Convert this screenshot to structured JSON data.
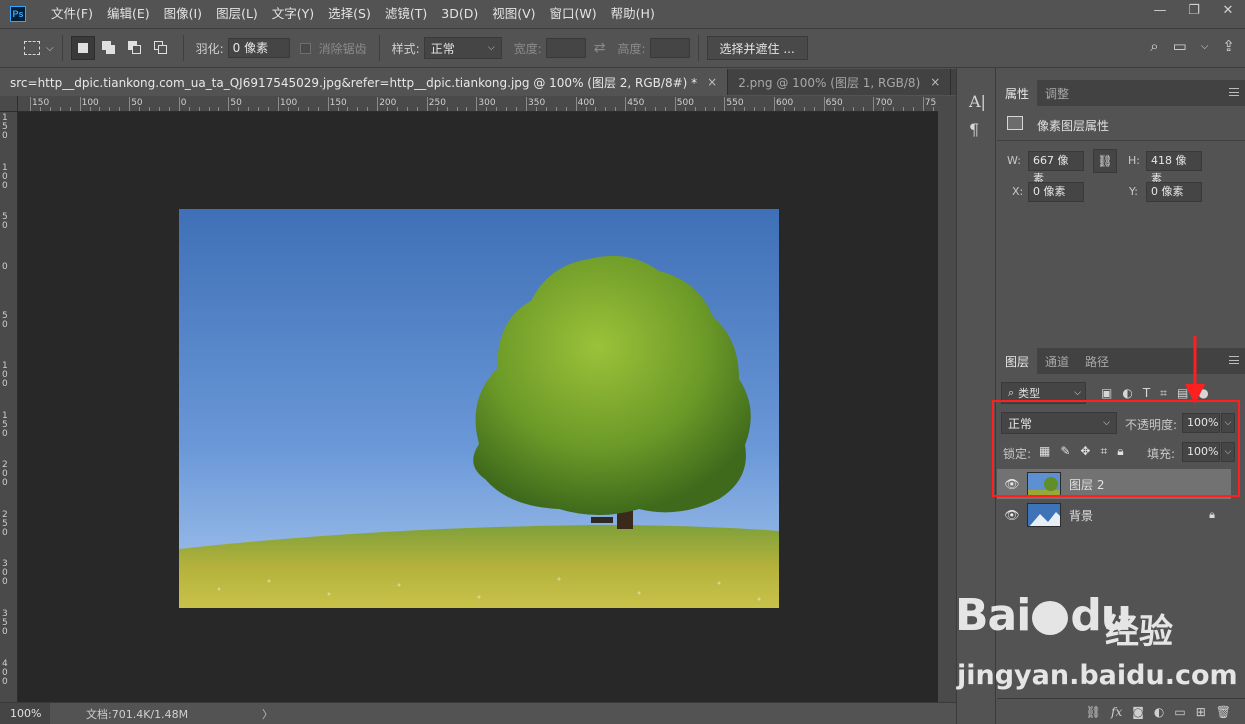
{
  "app": {
    "logo_text": "Ps"
  },
  "menu": [
    "文件(F)",
    "编辑(E)",
    "图像(I)",
    "图层(L)",
    "文字(Y)",
    "选择(S)",
    "滤镜(T)",
    "3D(D)",
    "视图(V)",
    "窗口(W)",
    "帮助(H)"
  ],
  "window_controls": {
    "minimize": "—",
    "restore": "❐",
    "close": "✕"
  },
  "options_bar": {
    "feather_label": "羽化:",
    "feather_value": "0 像素",
    "antialias_label": "消除锯齿",
    "style_label": "样式:",
    "style_value": "正常",
    "width_label": "宽度:",
    "height_label": "高度:",
    "select_mask_button": "选择并遮住 ..."
  },
  "tabs": [
    {
      "label": "src=http__dpic.tiankong.com_ua_ta_QJ6917545029.jpg&refer=http__dpic.tiankong.jpg @ 100% (图层 2, RGB/8#) *",
      "close": "×"
    },
    {
      "label": "2.png @ 100% (图层 1, RGB/8)",
      "close": "×"
    }
  ],
  "rulers": {
    "top": [
      "150",
      "100",
      "50",
      "0",
      "50",
      "100",
      "150",
      "200",
      "250",
      "300",
      "350",
      "400",
      "450",
      "500",
      "550",
      "600",
      "650",
      "700",
      "75"
    ],
    "left": [
      "1 5 0",
      "1 0 0",
      "5 0",
      "0",
      "5 0",
      "1 0 0",
      "1 5 0",
      "2 0 0",
      "2 5 0",
      "3 0 0",
      "3 5 0",
      "4 0 0",
      "4 5 0"
    ]
  },
  "status": {
    "zoom": "100%",
    "doc_info": "文档:701.4K/1.48M",
    "arrow": "〉"
  },
  "icon_column": {
    "text_tool": "A|",
    "paragraph": "¶"
  },
  "properties_panel": {
    "tabs": [
      "属性",
      "调整"
    ],
    "header": "像素图层属性",
    "w_label": "W:",
    "w_value": "667 像素",
    "h_label": "H:",
    "h_value": "418 像素",
    "x_label": "X:",
    "x_value": "0 像素",
    "y_label": "Y:",
    "y_value": "0 像素"
  },
  "layers_panel": {
    "tabs": [
      "图层",
      "通道",
      "路径"
    ],
    "filter_kind": "类型",
    "blend_mode": "正常",
    "opacity_label": "不透明度:",
    "opacity_value": "100%",
    "lock_label": "锁定:",
    "fill_label": "填充:",
    "fill_value": "100%",
    "layers": [
      {
        "name": "图层 2",
        "selected": true
      },
      {
        "name": "背景",
        "locked": true
      }
    ]
  },
  "watermark": {
    "logo": "Bai",
    "logo2": "du",
    "cn": "经验",
    "url": "jingyan.baidu.com"
  },
  "colors": {
    "highlight": "#ff1f1f",
    "ui_bg": "#535353",
    "canvas_bg": "#282828"
  }
}
